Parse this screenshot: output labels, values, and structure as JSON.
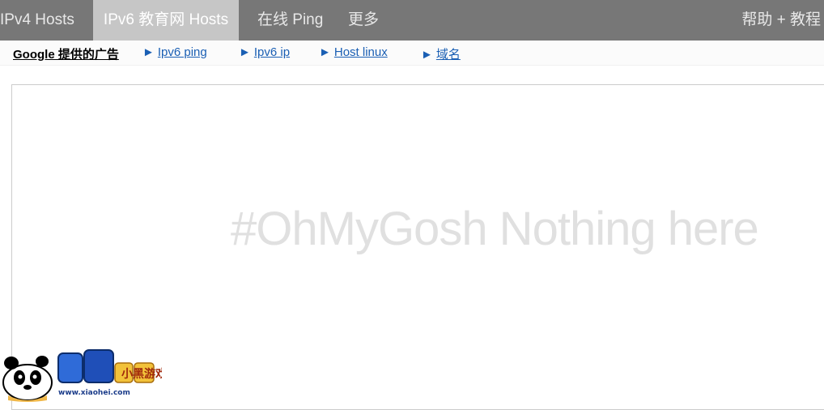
{
  "navbar": {
    "items": [
      {
        "label": "IPv4 Hosts"
      },
      {
        "label": "IPv6 教育网 Hosts"
      },
      {
        "label": "在线 Ping"
      },
      {
        "label": "更多"
      }
    ],
    "help_label": "帮助 + 教程"
  },
  "ad_bar": {
    "label": "Google 提供的广告",
    "links": [
      {
        "arrow": "►",
        "label": "Ipv6 ping"
      },
      {
        "arrow": "►",
        "label": "Ipv6 ip"
      },
      {
        "arrow": "►",
        "label": "Host linux"
      },
      {
        "arrow": "►",
        "label": "域名"
      }
    ]
  },
  "content": {
    "empty_message": "#OhMyGosh Nothing here"
  },
  "watermark": {
    "logo_text": "小黑游戏",
    "url": "www.xiaohei.com"
  },
  "colors": {
    "navbar_bg": "#777777",
    "active_tab_bg": "#c6c6c6",
    "link": "#1a5fb4",
    "empty_text": "#e0e0e0"
  }
}
